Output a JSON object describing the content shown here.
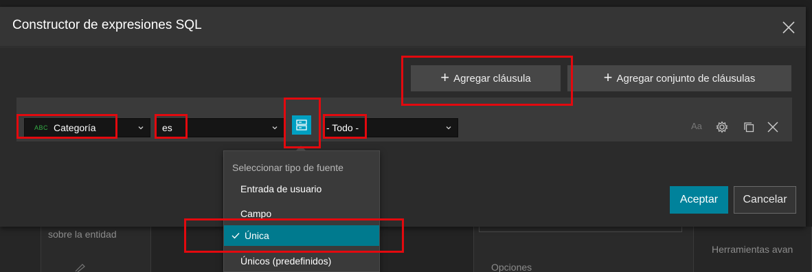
{
  "dialog": {
    "title": "Constructor de expresiones SQL",
    "add_clause_label": "Agregar cláusula",
    "add_clause_set_label": "Agregar conjunto de cláusulas",
    "accept_label": "Aceptar",
    "cancel_label": "Cancelar"
  },
  "clause": {
    "field_type_badge": "ABC",
    "field_value": "Categoría",
    "operator_value": "es",
    "value_value": "- Todo -",
    "case_sensitive_label": "Aa"
  },
  "source_menu": {
    "heading": "Seleccionar tipo de fuente",
    "items": [
      {
        "label": "Entrada de usuario",
        "selected": false
      },
      {
        "label": "Campo",
        "selected": false
      },
      {
        "label": "Única",
        "selected": true
      },
      {
        "label": "Únicos (predefinidos)",
        "selected": false
      }
    ]
  },
  "background": {
    "entity_text": "sobre la entidad",
    "tools_text": "Herramientas avan",
    "options_text": "Opciones"
  },
  "colors": {
    "accent": "#00a0c2",
    "primary_button": "#00829b",
    "highlight": "#e3090e",
    "field_type_green": "#35ac46"
  },
  "icons": [
    "close-icon",
    "plus-icon",
    "chevron-down-icon",
    "source-type-icon",
    "settings-icon",
    "copy-icon",
    "delete-icon",
    "check-icon",
    "pencil-icon"
  ]
}
